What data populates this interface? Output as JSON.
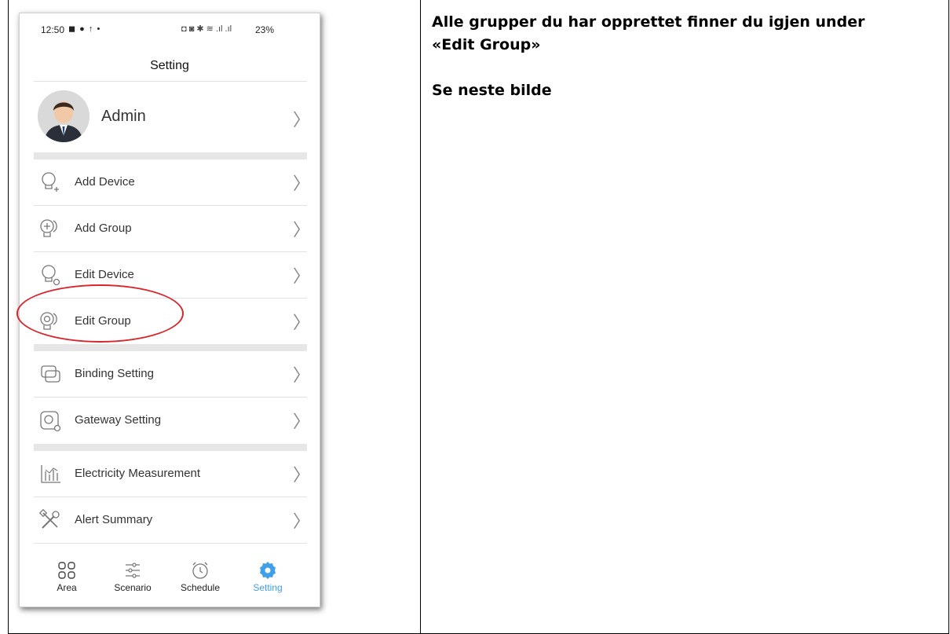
{
  "instructions": {
    "line1": "Alle grupper du har opprettet finner du igjen under",
    "line2": "«Edit Group»",
    "line3": "Se neste bilde"
  },
  "status_bar": {
    "time": "12:50",
    "left_icons": "◼ ● ↑ •",
    "right_icons": "◘ ◙ ✱ ≋ .ıl .ıl",
    "battery": "23%"
  },
  "header": {
    "title": "Setting"
  },
  "profile": {
    "name": "Admin"
  },
  "menu": {
    "items": [
      {
        "label": "Add Device",
        "icon": "bulb-plus-icon"
      },
      {
        "label": "Add Group",
        "icon": "group-plus-icon"
      },
      {
        "label": "Edit Device",
        "icon": "bulb-gear-icon"
      },
      {
        "label": "Edit Group",
        "icon": "group-gear-icon"
      },
      {
        "label": "Binding Setting",
        "icon": "binding-icon"
      },
      {
        "label": "Gateway Setting",
        "icon": "gateway-icon"
      },
      {
        "label": "Electricity Measurement",
        "icon": "electricity-chart-icon"
      },
      {
        "label": "Alert Summary",
        "icon": "tools-icon"
      }
    ]
  },
  "tabs": [
    {
      "label": "Area",
      "icon": "grid-icon",
      "active": false
    },
    {
      "label": "Scenario",
      "icon": "sliders-icon",
      "active": false
    },
    {
      "label": "Schedule",
      "icon": "clock-icon",
      "active": false
    },
    {
      "label": "Setting",
      "icon": "gear-icon",
      "active": true
    }
  ],
  "colors": {
    "accent": "#3f9fe8",
    "highlight_circle": "#d8262c"
  }
}
